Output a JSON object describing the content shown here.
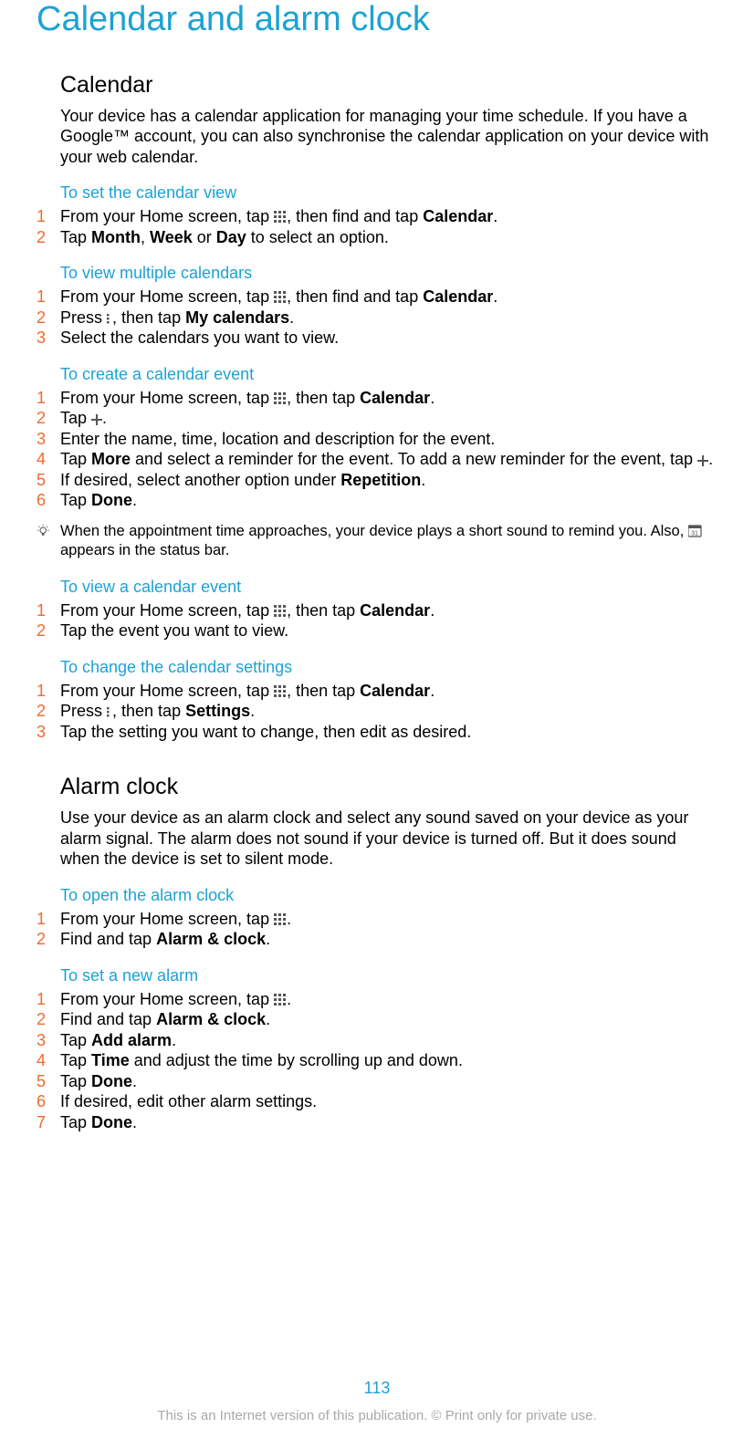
{
  "title": "Calendar and alarm clock",
  "page_number": "113",
  "footer_note": "This is an Internet version of this publication. © Print only for private use.",
  "calendar": {
    "heading": "Calendar",
    "intro": "Your device has a calendar application for managing your time schedule. If you have a Google™ account, you can also synchronise the calendar application on your device with your web calendar.",
    "set_view": {
      "title": "To set the calendar view",
      "s1a": "From your Home screen, tap ",
      "s1b": ", then find and tap ",
      "s1c": "Calendar",
      "s1d": ".",
      "s2a": "Tap ",
      "s2b": "Month",
      "s2c": ", ",
      "s2d": "Week",
      "s2e": " or ",
      "s2f": "Day",
      "s2g": " to select an option."
    },
    "multi": {
      "title": "To view multiple calendars",
      "s1a": "From your Home screen, tap ",
      "s1b": ", then find and tap ",
      "s1c": "Calendar",
      "s1d": ".",
      "s2a": "Press ",
      "s2b": ", then tap ",
      "s2c": "My calendars",
      "s2d": ".",
      "s3": "Select the calendars you want to view."
    },
    "create": {
      "title": "To create a calendar event",
      "s1a": "From your Home screen, tap ",
      "s1b": ", then tap ",
      "s1c": "Calendar",
      "s1d": ".",
      "s2a": "Tap ",
      "s2b": ".",
      "s3": "Enter the name, time, location and description for the event.",
      "s4a": "Tap ",
      "s4b": "More",
      "s4c": " and select a reminder for the event. To add a new reminder for the event, tap ",
      "s4d": ".",
      "s5a": "If desired, select another option under ",
      "s5b": "Repetition",
      "s5c": ".",
      "s6a": "Tap ",
      "s6b": "Done",
      "s6c": ".",
      "tip_a": "When the appointment time approaches, your device plays a short sound to remind you. Also, ",
      "tip_b": " appears in the status bar."
    },
    "view_event": {
      "title": "To view a calendar event",
      "s1a": "From your Home screen, tap ",
      "s1b": ", then tap ",
      "s1c": "Calendar",
      "s1d": ".",
      "s2": "Tap the event you want to view."
    },
    "settings": {
      "title": "To change the calendar settings",
      "s1a": "From your Home screen, tap ",
      "s1b": ", then tap ",
      "s1c": "Calendar",
      "s1d": ".",
      "s2a": "Press ",
      "s2b": ", then tap ",
      "s2c": "Settings",
      "s2d": ".",
      "s3": "Tap the setting you want to change, then edit as desired."
    }
  },
  "alarm": {
    "heading": "Alarm clock",
    "intro": "Use your device as an alarm clock and select any sound saved on your device as your alarm signal. The alarm does not sound if your device is turned off. But it does sound when the device is set to silent mode.",
    "open": {
      "title": "To open the alarm clock",
      "s1a": "From your Home screen, tap ",
      "s1b": ".",
      "s2a": "Find and tap ",
      "s2b": "Alarm & clock",
      "s2c": "."
    },
    "set": {
      "title": "To set a new alarm",
      "s1a": "From your Home screen, tap ",
      "s1b": ".",
      "s2a": "Find and tap ",
      "s2b": "Alarm & clock",
      "s2c": ".",
      "s3a": "Tap ",
      "s3b": "Add alarm",
      "s3c": ".",
      "s4a": "Tap ",
      "s4b": "Time",
      "s4c": " and adjust the time by scrolling up and down.",
      "s5a": "Tap ",
      "s5b": "Done",
      "s5c": ".",
      "s6": "If desired, edit other alarm settings.",
      "s7a": "Tap ",
      "s7b": "Done",
      "s7c": "."
    }
  },
  "nums": {
    "1": "1",
    "2": "2",
    "3": "3",
    "4": "4",
    "5": "5",
    "6": "6",
    "7": "7"
  }
}
